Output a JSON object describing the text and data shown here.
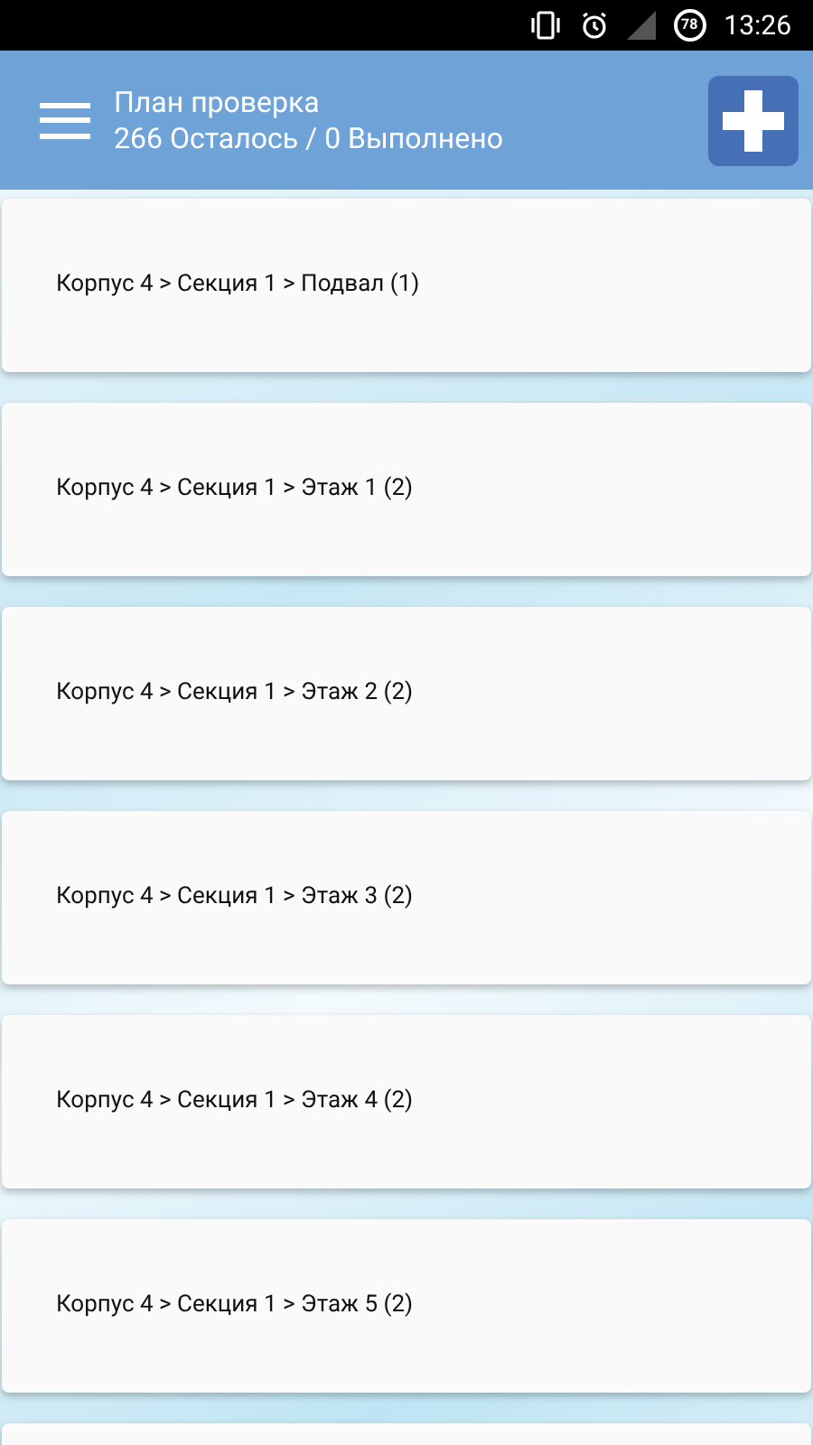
{
  "status_bar": {
    "battery": "78",
    "time": "13:26"
  },
  "app_bar": {
    "title": "План проверка",
    "subtitle": "266 Осталось / 0 Выполнено"
  },
  "items": [
    {
      "label": "Корпус 4 > Секция 1 > Подвал (1)"
    },
    {
      "label": "Корпус 4 > Секция 1 > Этаж 1 (2)"
    },
    {
      "label": "Корпус 4 > Секция 1 > Этаж 2 (2)"
    },
    {
      "label": "Корпус 4 > Секция 1 > Этаж 3 (2)"
    },
    {
      "label": "Корпус 4 > Секция 1 > Этаж 4 (2)"
    },
    {
      "label": "Корпус 4 > Секция 1 > Этаж 5 (2)"
    }
  ]
}
